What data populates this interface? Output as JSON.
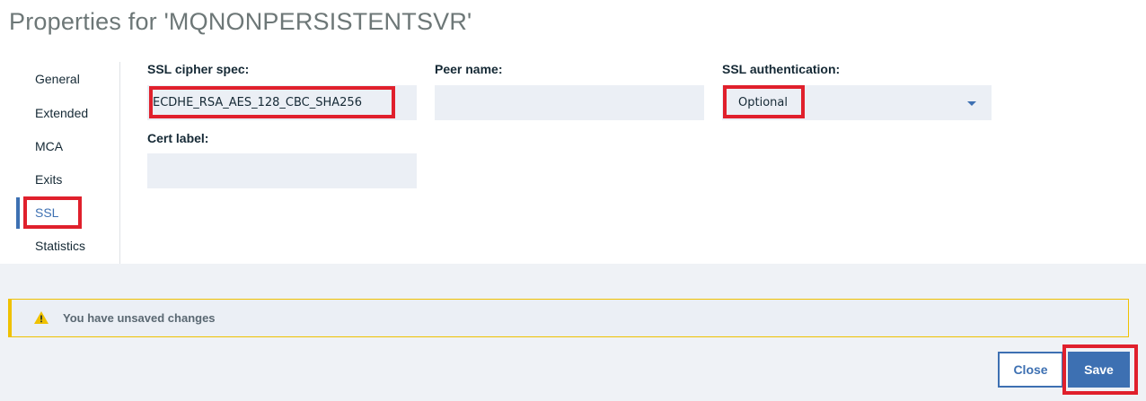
{
  "title": "Properties for 'MQNONPERSISTENTSVR'",
  "nav": {
    "items": [
      {
        "label": "General"
      },
      {
        "label": "Extended"
      },
      {
        "label": "MCA"
      },
      {
        "label": "Exits"
      },
      {
        "label": "SSL"
      },
      {
        "label": "Statistics"
      }
    ],
    "active": "SSL"
  },
  "fields": {
    "ssl_cipher_spec": {
      "label": "SSL cipher spec:",
      "value": "ECDHE_RSA_AES_128_CBC_SHA256"
    },
    "peer_name": {
      "label": "Peer name:",
      "value": ""
    },
    "ssl_authentication": {
      "label": "SSL authentication:",
      "value": "Optional"
    },
    "cert_label": {
      "label": "Cert label:",
      "value": ""
    }
  },
  "warning": {
    "text": "You have unsaved changes",
    "icon": "warning-icon",
    "color": "#efc100"
  },
  "buttons": {
    "close": "Close",
    "save": "Save"
  },
  "colors": {
    "accent": "#3d70b2",
    "highlight": "#e0202c",
    "field_bg": "#ebeff5"
  }
}
